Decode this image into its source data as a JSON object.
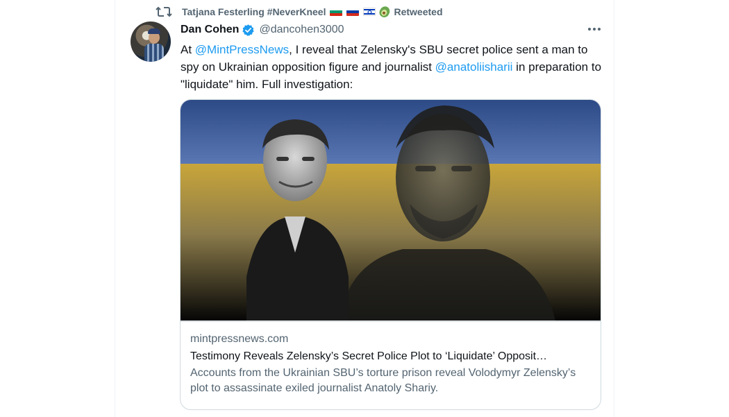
{
  "retweet": {
    "retweeter_name": "Tatjana Festerling #NeverKneel",
    "status": "Retweeted",
    "emoji_icons": [
      "flag-bulgaria-icon",
      "flag-russia-icon",
      "flag-israel-icon",
      "avocado-icon"
    ]
  },
  "tweet": {
    "display_name": "Dan Cohen",
    "handle": "@dancohen3000",
    "verified": true,
    "text": {
      "t1": "At ",
      "mention1": "@MintPressNews",
      "t2": ", I reveal that Zelensky's SBU secret police sent a man to spy on Ukrainian opposition figure and journalist ",
      "mention2": "@anatoliisharii",
      "t3": " in preparation to \"liquidate\" him. Full investigation:"
    }
  },
  "card": {
    "domain": "mintpressnews.com",
    "title": "Testimony Reveals Zelensky’s Secret Police Plot to ‘Liquidate’ Opposit…",
    "description": "Accounts from the Ukrainian SBU’s torture prison reveal Volodymyr Zelensky’s plot to assassinate exiled journalist Anatoly Shariy."
  },
  "colors": {
    "accent": "#1d9bf0",
    "secondary_text": "#536471",
    "flag_blue": "#3a5aa0",
    "flag_yellow": "#c9a63a"
  }
}
